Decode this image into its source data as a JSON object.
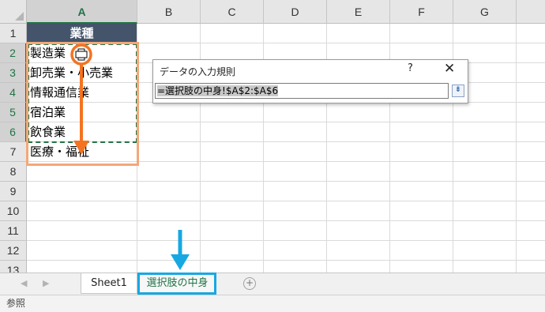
{
  "columns": [
    "A",
    "B",
    "C",
    "D",
    "E",
    "F",
    "G"
  ],
  "rows": [
    "1",
    "2",
    "3",
    "4",
    "5",
    "6",
    "7",
    "8",
    "9",
    "10",
    "11",
    "12",
    "13"
  ],
  "header_cell": "業種",
  "cells": [
    "製造業",
    "卸売業・小売業",
    "情報通信業",
    "宿泊業",
    "飲食業",
    "医療・福祉"
  ],
  "dialog": {
    "title": "データの入力規則",
    "help": "?",
    "close": "✕",
    "formula": "=選択肢の中身!$A$2:$A$6",
    "collapse_glyph": "⇟"
  },
  "tabs": {
    "prev": "◀",
    "next": "▶",
    "sheet1": "Sheet1",
    "sheet2": "選択肢の中身",
    "add": "+"
  },
  "status": "参照",
  "colors": {
    "header_fill": "#44546a",
    "excel_green": "#217346",
    "orange": "#f47321",
    "cyan": "#17a8e3"
  }
}
